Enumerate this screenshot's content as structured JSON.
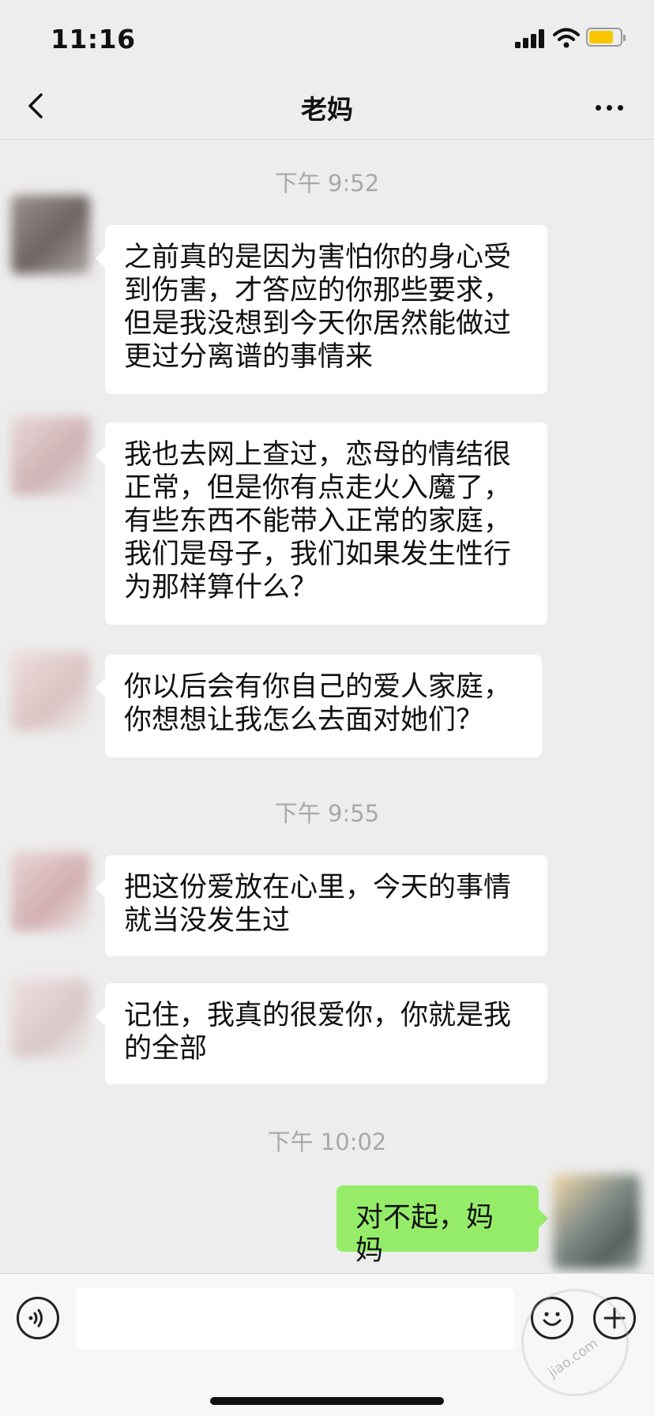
{
  "status_bar": {
    "time": "11:16"
  },
  "nav": {
    "title": "老妈"
  },
  "messages": {
    "ts1": "下午 9:52",
    "m1": "之前真的是因为害怕你的身心受\n到伤害，才答应的你那些要求，\n但是我没想到今天你居然能做过\n更过分离谱的事情来",
    "m2": "我也去网上查过，恋母的情结很\n正常，但是你有点走火入魔了，\n有些东西不能带入正常的家庭，\n我们是母子，我们如果发生性行\n为那样算什么？",
    "m3": "你以后会有你自己的爱人家庭，\n你想想让我怎么去面对她们？",
    "ts2": "下午 9:55",
    "m4": "把这份爱放在心里，今天的事情\n就当没发生过",
    "m5": "记住，我真的很爱你，你就是我\n的全部",
    "ts3": "下午 10:02",
    "m6": "对不起，妈妈"
  },
  "input_bar": {
    "value": ""
  },
  "icons": {
    "back": "chevron-left-icon",
    "more": "ellipsis-icon",
    "voice": "voice-icon",
    "emoji": "emoji-icon",
    "plus": "plus-icon"
  },
  "colors": {
    "background": "#ededed",
    "incoming_bubble": "#ffffff",
    "outgoing_bubble": "#95ec69",
    "timestamp": "#a8a8a8",
    "battery": "#f7c600"
  },
  "battery_level": 0.8,
  "watermark": {
    "text": "jiao.com"
  }
}
